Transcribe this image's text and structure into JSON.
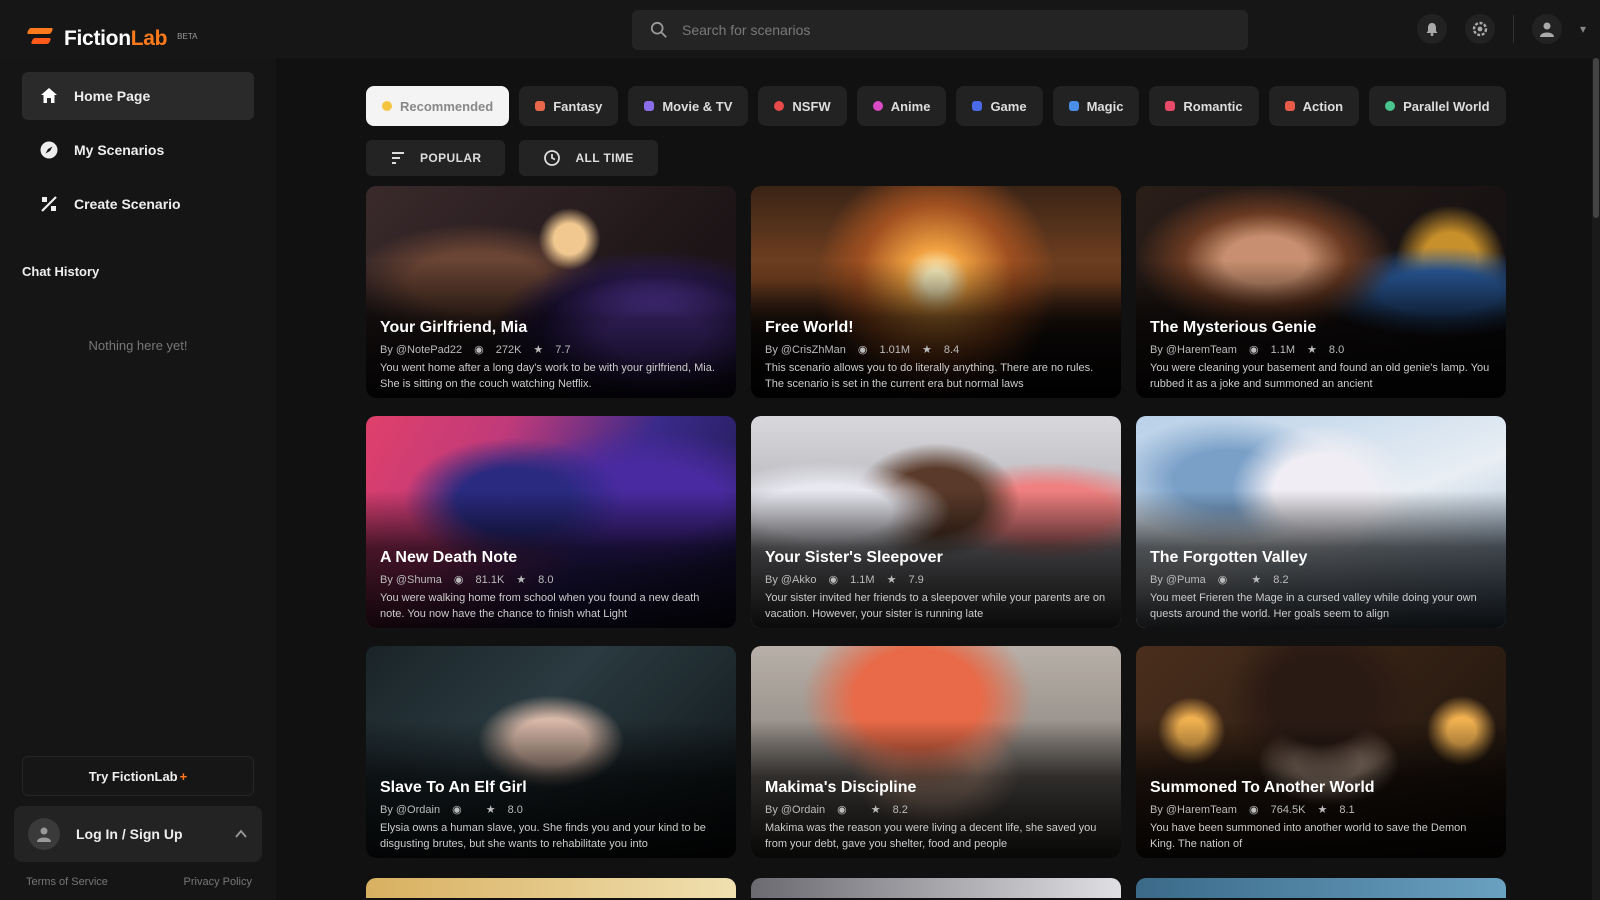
{
  "brand": {
    "name_part1": "Fiction",
    "name_part2": "Lab",
    "badge": "BETA"
  },
  "search": {
    "placeholder": "Search for scenarios"
  },
  "sidebar": {
    "items": [
      {
        "label": "Home Page"
      },
      {
        "label": "My Scenarios"
      },
      {
        "label": "Create Scenario"
      }
    ],
    "chat_history_title": "Chat History",
    "chat_history_empty": "Nothing here yet!",
    "try_label": "Try FictionLab",
    "try_plus": "+",
    "login_label": "Log In / Sign Up",
    "footer": {
      "terms": "Terms of Service",
      "privacy": "Privacy Policy"
    }
  },
  "categories": [
    {
      "label": "Recommended",
      "color": "#f5c542"
    },
    {
      "label": "Fantasy",
      "color": "#e8694a"
    },
    {
      "label": "Movie & TV",
      "color": "#8a6de8"
    },
    {
      "label": "NSFW",
      "color": "#e84a4a"
    },
    {
      "label": "Anime",
      "color": "#d94ac4"
    },
    {
      "label": "Game",
      "color": "#4a6ae8"
    },
    {
      "label": "Magic",
      "color": "#4a8ee8"
    },
    {
      "label": "Romantic",
      "color": "#e84a6a"
    },
    {
      "label": "Action",
      "color": "#e85a4a"
    },
    {
      "label": "Parallel World",
      "color": "#4ac48e"
    }
  ],
  "filters": {
    "sort": "POPULAR",
    "time": "ALL TIME"
  },
  "scenarios": [
    {
      "title": "Your Girlfriend, Mia",
      "author": "By @NotePad22",
      "views": "272K",
      "rating": "7.7",
      "desc": "You went home after a long day's work to be with your girlfriend, Mia. She is sitting on the couch watching Netflix."
    },
    {
      "title": "Free World!",
      "author": "By @CrisZhMan",
      "views": "1.01M",
      "rating": "8.4",
      "desc": "This scenario allows you to do literally anything. There are no rules. The scenario is set in the current era but normal laws"
    },
    {
      "title": "The Mysterious Genie",
      "author": "By @HaremTeam",
      "views": "1.1M",
      "rating": "8.0",
      "desc": "You were cleaning your basement and found an old genie's lamp. You rubbed it as a joke and summoned an ancient"
    },
    {
      "title": "A New Death Note",
      "author": "By @Shuma",
      "views": "81.1K",
      "rating": "8.0",
      "desc": "You were walking home from school when you found a new death note. You now have the chance to finish what Light"
    },
    {
      "title": "Your Sister's Sleepover",
      "author": "By @Akko",
      "views": "1.1M",
      "rating": "7.9",
      "desc": "Your sister invited her friends to a sleepover while your parents are on vacation. However, your sister is running late"
    },
    {
      "title": "The Forgotten Valley",
      "author": "By @Puma",
      "views": "",
      "rating": "8.2",
      "desc": "You meet Frieren the Mage in a cursed valley while doing your own quests around the world. Her goals seem to align"
    },
    {
      "title": "Slave To An Elf Girl",
      "author": "By @Ordain",
      "views": "",
      "rating": "8.0",
      "desc": "Elysia owns a human slave, you. She finds you and your kind to be disgusting brutes, but she wants to rehabilitate you into"
    },
    {
      "title": "Makima's Discipline",
      "author": "By @Ordain",
      "views": "",
      "rating": "8.2",
      "desc": "Makima was the reason you were living a decent life, she saved you from your debt, gave you shelter, food and people"
    },
    {
      "title": "Summoned To Another World",
      "author": "By @HaremTeam",
      "views": "764.5K",
      "rating": "8.1",
      "desc": "You have been summoned into another world to save the Demon King. The nation of"
    }
  ]
}
